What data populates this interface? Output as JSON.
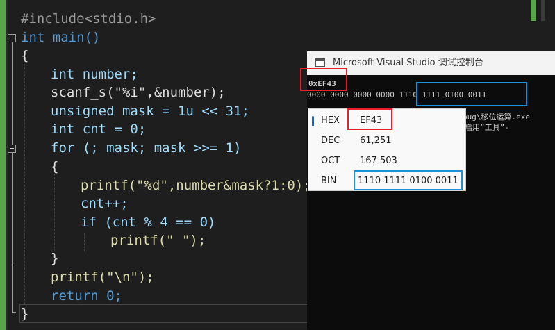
{
  "editor": {
    "lines": [
      {
        "t": "#include<stdio.h>"
      },
      {
        "t": "int main()"
      },
      {
        "t": "{"
      },
      {
        "t": "int number;"
      },
      {
        "t": "scanf_s(\"%i\",&number);"
      },
      {
        "t": "unsigned mask = 1u << 31;"
      },
      {
        "t": "int cnt = 0;"
      },
      {
        "t": "for (; mask; mask >>= 1)"
      },
      {
        "t": "{"
      },
      {
        "t": "printf(\"%d\",number&mask?1:0);"
      },
      {
        "t": "cnt++;"
      },
      {
        "t": "if (cnt % 4 == 0)"
      },
      {
        "t": "printf(\" \");"
      },
      {
        "t": "}"
      },
      {
        "t": "printf(\"\\n\");"
      },
      {
        "t": "return 0;"
      },
      {
        "t": "}"
      }
    ]
  },
  "console": {
    "title": "Microsoft Visual Studio 调试控制台",
    "hex_output": "0xEF43",
    "bin_output": "0000 0000 0000 0000 1110 1111 0100 0011",
    "path_fragment": "bug\\移位运算.exe",
    "tools_fragment": "请启用“工具”-"
  },
  "calculator": {
    "rows": [
      {
        "label": "HEX",
        "value": "EF43"
      },
      {
        "label": "DEC",
        "value": "61,251"
      },
      {
        "label": "OCT",
        "value": "167 503"
      },
      {
        "label": "BIN",
        "value": "1110 1111 0100 0011"
      }
    ]
  },
  "colors": {
    "annotation_red": "#e8202a",
    "annotation_blue": "#1e90d8",
    "margin_green": "#57a64a"
  }
}
